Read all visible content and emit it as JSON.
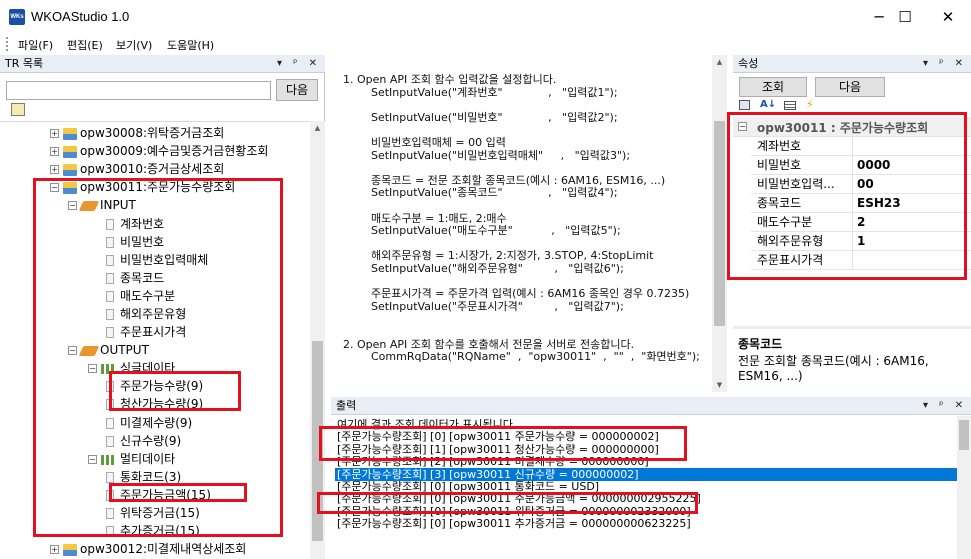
{
  "window": {
    "app_icon_label": "WKs",
    "title": "WKOAStudio 1.0",
    "minimize_glyph": "─",
    "maximize_glyph": "☐",
    "close_glyph": "✕"
  },
  "menu": [
    "파일(F)",
    "편집(E)",
    "보기(V)",
    "도움말(H)"
  ],
  "tr_panel": {
    "title": "TR 목록",
    "header_icons": "▾ ᵖ ✕",
    "search_value": "",
    "search_button": "다음",
    "tree": [
      {
        "label": "opw30008:위탁증거금조회",
        "kind": "tr"
      },
      {
        "label": "opw30009:예수금및증거금현황조회",
        "kind": "tr"
      },
      {
        "label": "opw30010:증거금상세조회",
        "kind": "tr"
      },
      {
        "label": "opw30011:주문가능수량조회",
        "kind": "tr"
      },
      {
        "label": "INPUT",
        "kind": "tag"
      },
      {
        "label": "계좌번호",
        "kind": "leaf"
      },
      {
        "label": "비밀번호",
        "kind": "leaf"
      },
      {
        "label": "비밀번호입력매체",
        "kind": "leaf"
      },
      {
        "label": "종목코드",
        "kind": "leaf"
      },
      {
        "label": "매도수구분",
        "kind": "leaf"
      },
      {
        "label": "해외주문유형",
        "kind": "leaf"
      },
      {
        "label": "주문표시가격",
        "kind": "leaf"
      },
      {
        "label": "OUTPUT",
        "kind": "tag"
      },
      {
        "label": "싱글데이타",
        "kind": "grid"
      },
      {
        "label": "주문가능수량(9)",
        "kind": "leaf"
      },
      {
        "label": "청산가능수량(9)",
        "kind": "leaf"
      },
      {
        "label": "미결제수량(9)",
        "kind": "leaf"
      },
      {
        "label": "신규수량(9)",
        "kind": "leaf"
      },
      {
        "label": "멀티데이타",
        "kind": "grid"
      },
      {
        "label": "통화코드(3)",
        "kind": "leaf"
      },
      {
        "label": "주문가능금액(15)",
        "kind": "leaf"
      },
      {
        "label": "위탁증거금(15)",
        "kind": "leaf"
      },
      {
        "label": "추가증거금(15)",
        "kind": "leaf"
      },
      {
        "label": "opw30012:미결제내역상세조회",
        "kind": "tr"
      }
    ]
  },
  "code": [
    "1. Open API 조회 함수 입력값을 설정합니다.",
    "        SetInputValue(\"계좌번호\"             ,   \"입력값1\");",
    "",
    "        SetInputValue(\"비밀번호\"             ,   \"입력값2\");",
    "",
    "        비밀번호입력매체 = 00 입력",
    "        SetInputValue(\"비밀번호입력매체\"     ,   \"입력값3\");",
    "",
    "        종목코드 = 전문 조회할 종목코드(예시 : 6AM16, ESM16, ...)",
    "        SetInputValue(\"종목코드\"             ,   \"입력값4\");",
    "",
    "        매도수구분 = 1:매도, 2:매수",
    "        SetInputValue(\"매도수구분\"           ,   \"입력값5\");",
    "",
    "        해외주문유형 = 1:시장가, 2:지정가, 3.STOP, 4:StopLimit",
    "        SetInputValue(\"해외주문유형\"         ,   \"입력값6\");",
    "",
    "        주문표시가격 = 주문가격 입력(예시 : 6AM16 종목인 경우 0.7235)",
    "        SetInputValue(\"주문표시가격\"         ,   \"입력값7\");",
    "",
    "",
    "2. Open API 조회 함수를 호출해서 전문을 서버로 전송합니다.",
    "        CommRqData(\"RQName\"  ,  \"opw30011\"  ,  \"\"  ,  \"화면번호\");"
  ],
  "properties": {
    "title": "속성",
    "header_icons": "▾ ᵖ ✕",
    "query_button": "조회",
    "next_button": "다음",
    "section_title": "opw30011 : 주문가능수량조회",
    "rows": [
      {
        "name": "계좌번호",
        "value": ""
      },
      {
        "name": "비밀번호",
        "value": "0000"
      },
      {
        "name": "비밀번호입력...",
        "value": "00"
      },
      {
        "name": "종목코드",
        "value": "ESH23"
      },
      {
        "name": "매도수구분",
        "value": "2"
      },
      {
        "name": "해외주문유형",
        "value": "1"
      },
      {
        "name": "주문표시가격",
        "value": ""
      }
    ],
    "desc_title": "종목코드",
    "desc_text_1": "전문 조회할 종목코드(예시 : 6AM16,",
    "desc_text_2": "ESM16, ...)"
  },
  "output": {
    "title": "출력",
    "header_icons": "▾ ᵖ ✕",
    "lines": [
      "여기에 결과 조회 데이터가 표시됩니다.",
      "[주문가능수량조회] [0] [opw30011 주문가능수량 = 000000002]",
      "[주문가능수량조회] [1] [opw30011 청산가능수량 = 000000000]",
      "[주문가능수량조회] [2] [opw30011 미결제수량 = 000000000]",
      "[주문가능수량조회] [3] [opw30011 신규수량 = 000000002]",
      "[주문가능수량조회] [0] [opw30011 통화코드 = USD]",
      "[주문가능수량조회] [0] [opw30011 주문가능금액 = 000000002955225]",
      "[주문가능수량조회] [0] [opw30011 위탁증거금 = 000000002332000]",
      "[주문가능수량조회] [0] [opw30011 추가증거금 = 000000000623225]"
    ]
  },
  "colors": {
    "highlight_box": "#e3101f",
    "selection": "#0078d7",
    "panel_header": "#e9edf5"
  }
}
